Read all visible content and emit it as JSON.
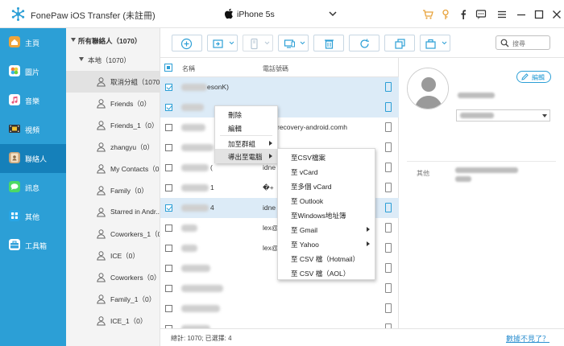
{
  "app": {
    "title": "FonePaw iOS Transfer (未註冊)"
  },
  "device": {
    "name": "iPhone 5s"
  },
  "colors": {
    "accent": "#2c9fd6",
    "accent_dark": "#1580ba",
    "window_button_orange": "#e8a23a",
    "link": "#2c8fd0"
  },
  "title_icons": [
    "cart-icon",
    "key-icon",
    "facebook-icon",
    "feedback-icon",
    "menu-icon",
    "minimize-icon",
    "maximize-icon",
    "close-icon"
  ],
  "sidebar": {
    "items": [
      {
        "label": "主頁",
        "icon": "home-icon",
        "color": "#f0a43a"
      },
      {
        "label": "圖片",
        "icon": "photos-icon",
        "color": "#f47c3a"
      },
      {
        "label": "音樂",
        "icon": "music-icon",
        "color": "#e9567a"
      },
      {
        "label": "視頻",
        "icon": "video-icon",
        "color": "#333333"
      },
      {
        "label": "聯絡人",
        "icon": "contacts-icon",
        "color": "#c9a57a"
      },
      {
        "label": "訊息",
        "icon": "messages-icon",
        "color": "#4cd964"
      },
      {
        "label": "其他",
        "icon": "apps-icon",
        "color": "#27a6e6"
      },
      {
        "label": "工具箱",
        "icon": "toolbox-icon",
        "color": "#2ea0da"
      }
    ]
  },
  "groups": {
    "all_label": "所有聯絡人（1070）",
    "local_label": "本地（1070）",
    "items": [
      {
        "label": "取消分組（1070）"
      },
      {
        "label": "Friends（0）"
      },
      {
        "label": "Friends_1（0）"
      },
      {
        "label": "zhangyu（0）"
      },
      {
        "label": "My Contacts（0）"
      },
      {
        "label": "Family（0）"
      },
      {
        "label": "Starred in Andr..."
      },
      {
        "label": "Coworkers_1（0）"
      },
      {
        "label": "ICE（0）"
      },
      {
        "label": "Coworkers（0）"
      },
      {
        "label": "Family_1（0）"
      },
      {
        "label": "ICE_1（0）"
      }
    ]
  },
  "toolbar": {
    "buttons": [
      "add-icon",
      "import-icon",
      "export-icon",
      "device-transfer-icon",
      "delete-icon",
      "refresh-icon",
      "duplicate-icon",
      "toolbox-icon"
    ],
    "search_placeholder": "搜尋"
  },
  "list": {
    "headers": {
      "name": "名稱",
      "phone": "電話號碼"
    },
    "rows": [
      {
        "name_visible": "esonK)",
        "phone": "",
        "selected": true
      },
      {
        "name_visible": "",
        "phone": "",
        "selected": true
      },
      {
        "name_visible": "",
        "phone": "recovery-android.comh",
        "selected": false
      },
      {
        "name_visible": "",
        "phone": "",
        "selected": false
      },
      {
        "name_visible": "(",
        "phone": "idne",
        "selected": false
      },
      {
        "name_visible": "1",
        "phone": "�+",
        "selected": false
      },
      {
        "name_visible": "4",
        "phone": "idne",
        "selected": true
      },
      {
        "name_visible": "",
        "phone": "lex@",
        "selected": false
      },
      {
        "name_visible": "",
        "phone": "lex@",
        "selected": false
      },
      {
        "name_visible": "",
        "phone": "",
        "selected": false
      },
      {
        "name_visible": "",
        "phone": "",
        "selected": false
      },
      {
        "name_visible": "",
        "phone": "",
        "selected": false
      },
      {
        "name_visible": "",
        "phone": "",
        "selected": false
      }
    ]
  },
  "status": {
    "text": "總計: 1070; 已選擇: 4",
    "link": "數據不見了？"
  },
  "detail": {
    "edit_label": "編輯",
    "field_label": "其他"
  },
  "context_menu": {
    "items": [
      {
        "label": "刪除",
        "has_submenu": false
      },
      {
        "label": "編輯",
        "has_submenu": false
      },
      {
        "label": "加至群組",
        "has_submenu": true
      },
      {
        "label": "導出至電腦",
        "has_submenu": true
      }
    ]
  },
  "submenu": {
    "items": [
      {
        "label": "至CSV檔案",
        "has_submenu": false
      },
      {
        "label": "至 vCard",
        "has_submenu": false
      },
      {
        "label": "至多個 vCard",
        "has_submenu": false
      },
      {
        "label": "至 Outlook",
        "has_submenu": false
      },
      {
        "label": "至Windows地址簿",
        "has_submenu": false
      },
      {
        "label": "至 Gmail",
        "has_submenu": true
      },
      {
        "label": "至 Yahoo",
        "has_submenu": true
      },
      {
        "label": "至 CSV 檔（Hotmail）",
        "has_submenu": false
      },
      {
        "label": "至 CSV 檔（AOL）",
        "has_submenu": false
      }
    ]
  }
}
